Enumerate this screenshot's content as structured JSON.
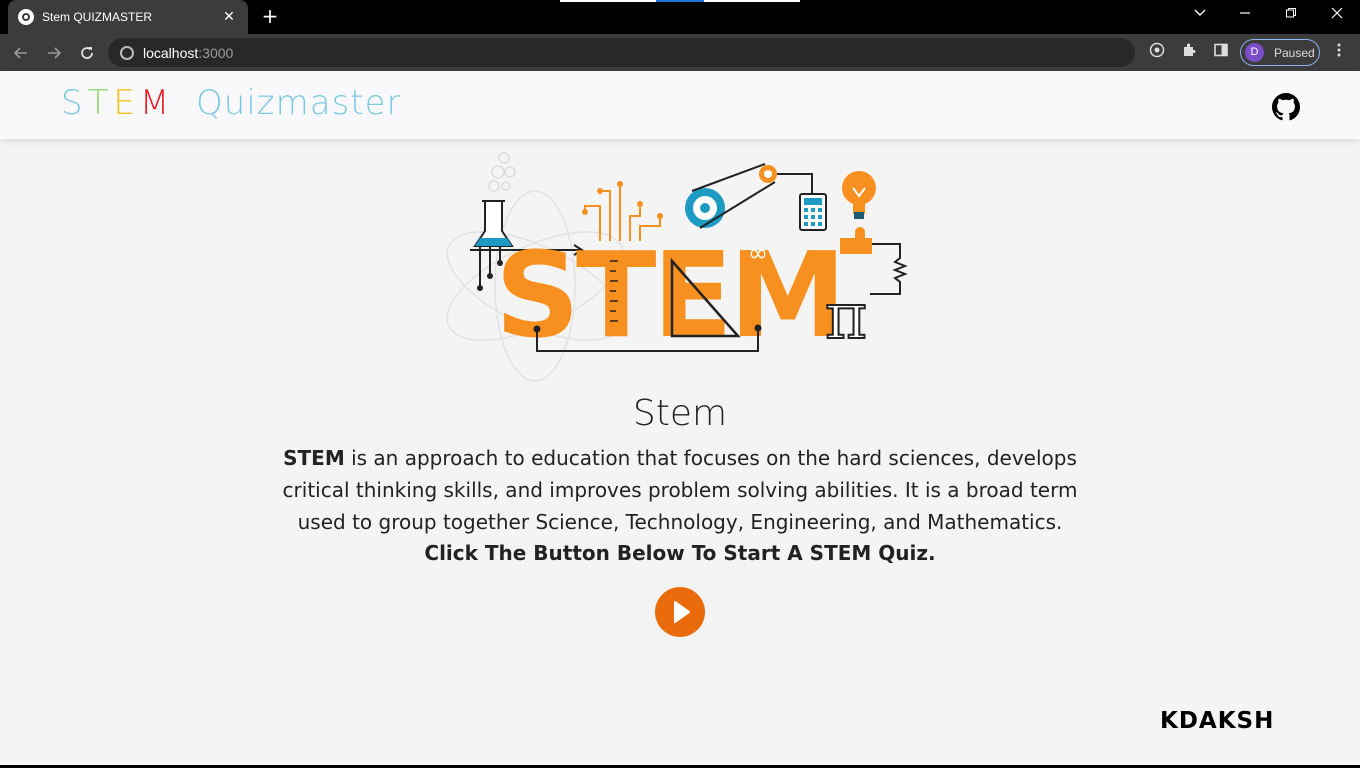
{
  "browser": {
    "tab_title": "Stem QUIZMASTER",
    "tab_close": "✕",
    "new_tab": "+",
    "url_host": "localhost",
    "url_port": ":3000",
    "profile_initial": "D",
    "profile_status": "Paused"
  },
  "header": {
    "logo_letters": [
      {
        "char": "S",
        "color": "#7ec8e3"
      },
      {
        "char": "T",
        "color": "#8fd96b"
      },
      {
        "char": "E",
        "color": "#f2c21b"
      },
      {
        "char": "M",
        "color": "#e8202a"
      }
    ],
    "logo_word": "Quizmaster",
    "logo_word_color": "#7ec8e3"
  },
  "hero": {
    "image_text": "STEM"
  },
  "content": {
    "heading": "Stem",
    "desc_bold": "STEM",
    "desc_line1_rest": " is an approach to education that focuses on the hard sciences, develops",
    "desc_line2": "critical thinking skills, and improves problem solving abilities. It is a broad term",
    "desc_line3": "used to group together Science, Technology, Engineering, and Mathematics.",
    "cta": "Click The Button Below To Start A STEM Quiz."
  },
  "footer": {
    "credit": "KDAKSH"
  },
  "colors": {
    "accent": "#e96b0c",
    "stem_orange": "#f7901e",
    "stem_blue": "#1e9bc3"
  }
}
